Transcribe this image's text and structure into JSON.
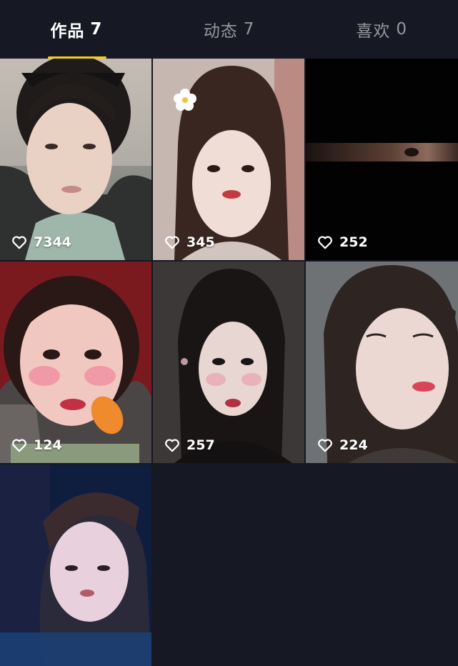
{
  "tabs": [
    {
      "label": "作品",
      "count": "7",
      "active": true
    },
    {
      "label": "动态",
      "count": "7",
      "active": false
    },
    {
      "label": "喜欢",
      "count": "0",
      "active": false
    }
  ],
  "videos": [
    {
      "likes": "7344",
      "icon": "heart-outline-icon"
    },
    {
      "likes": "345",
      "icon": "heart-outline-icon"
    },
    {
      "likes": "252",
      "icon": "heart-outline-icon"
    },
    {
      "likes": "124",
      "icon": "heart-outline-icon"
    },
    {
      "likes": "257",
      "icon": "heart-outline-icon"
    },
    {
      "likes": "224",
      "icon": "heart-outline-icon"
    },
    {
      "likes": "",
      "icon": ""
    }
  ],
  "colors": {
    "background": "#161823",
    "tab_indicator": "#face15"
  }
}
